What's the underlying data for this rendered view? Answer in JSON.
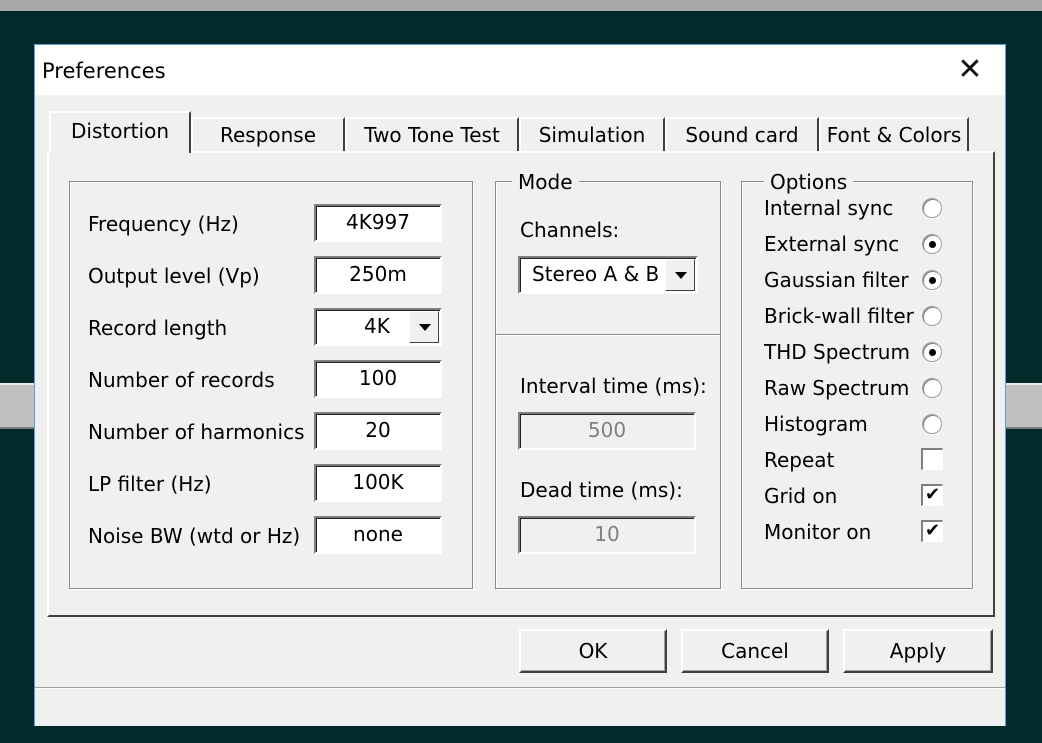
{
  "dialog": {
    "title": "Preferences",
    "close_glyph": "✕"
  },
  "tabs": [
    {
      "label": "Distortion",
      "active": true
    },
    {
      "label": "Response",
      "active": false
    },
    {
      "label": "Two Tone Test",
      "active": false
    },
    {
      "label": "Simulation",
      "active": false
    },
    {
      "label": "Sound card",
      "active": false
    },
    {
      "label": "Font & Colors",
      "active": false
    }
  ],
  "params": [
    {
      "label": "Frequency (Hz)",
      "value": "4K997"
    },
    {
      "label": "Output level (Vp)",
      "value": "250m"
    },
    {
      "label": "Record length",
      "value": "4K"
    },
    {
      "label": "Number of records",
      "value": "100"
    },
    {
      "label": "Number of harmonics",
      "value": "20"
    },
    {
      "label": "LP filter (Hz)",
      "value": "100K"
    },
    {
      "label": "Noise BW (wtd or Hz)",
      "value": "none"
    }
  ],
  "mode": {
    "legend": "Mode",
    "channels_label": "Channels:",
    "channels_value": "Stereo A & B",
    "interval_label": "Interval time (ms):",
    "interval_value": "500",
    "dead_label": "Dead time (ms):",
    "dead_value": "10"
  },
  "options": {
    "legend": "Options",
    "items": [
      {
        "label": "Internal sync",
        "type": "radio",
        "checked": false
      },
      {
        "label": "External sync",
        "type": "radio",
        "checked": true
      },
      {
        "label": "Gaussian filter",
        "type": "radio",
        "checked": true
      },
      {
        "label": "Brick-wall filter",
        "type": "radio",
        "checked": false
      },
      {
        "label": "THD Spectrum",
        "type": "radio",
        "checked": true
      },
      {
        "label": "Raw Spectrum",
        "type": "radio",
        "checked": false
      },
      {
        "label": "Histogram",
        "type": "radio",
        "checked": false
      },
      {
        "label": "Repeat",
        "type": "check",
        "checked": false
      },
      {
        "label": "Grid on",
        "type": "check",
        "checked": true
      },
      {
        "label": "Monitor on",
        "type": "check",
        "checked": true
      }
    ]
  },
  "buttons": {
    "ok": "OK",
    "cancel": "Cancel",
    "apply": "Apply"
  }
}
